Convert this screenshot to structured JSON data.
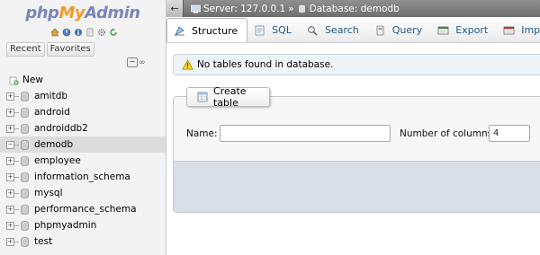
{
  "logo": {
    "php": "php",
    "my": "My",
    "admin": "Admin"
  },
  "nav": {
    "quick_icons": [
      "home-icon",
      "logout-icon",
      "docs-icon",
      "sql-docs-icon",
      "settings-icon",
      "reload-icon"
    ],
    "tabs": [
      "Recent",
      "Favorites"
    ],
    "collapse_label": "−",
    "link_label": "∞",
    "new_label": "New",
    "databases": [
      "amitdb",
      "android",
      "androiddb2",
      "demodb",
      "employee",
      "information_schema",
      "mysql",
      "performance_schema",
      "phpmyadmin",
      "test"
    ],
    "selected_db": "demodb"
  },
  "breadcrumb": {
    "server": "Server: 127.0.0.1",
    "separator": "»",
    "database": "Database: demodb"
  },
  "menu": {
    "tabs": [
      {
        "label": "Structure",
        "icon": "structure-icon"
      },
      {
        "label": "SQL",
        "icon": "sql-icon"
      },
      {
        "label": "Search",
        "icon": "search-icon"
      },
      {
        "label": "Query",
        "icon": "query-icon"
      },
      {
        "label": "Export",
        "icon": "export-icon"
      },
      {
        "label": "Import",
        "icon": "import-icon"
      }
    ],
    "active": "Structure"
  },
  "notice": {
    "text": "No tables found in database."
  },
  "create_table": {
    "legend": "Create table",
    "name_label": "Name:",
    "name_value": "",
    "columns_label": "Number of columns:",
    "columns_value": "4"
  },
  "colors": {
    "accent": "#235a81",
    "topbar": "#7d7d7d",
    "notice_bg": "#eef4f8",
    "fieldset_foot": "#d7dee7"
  }
}
